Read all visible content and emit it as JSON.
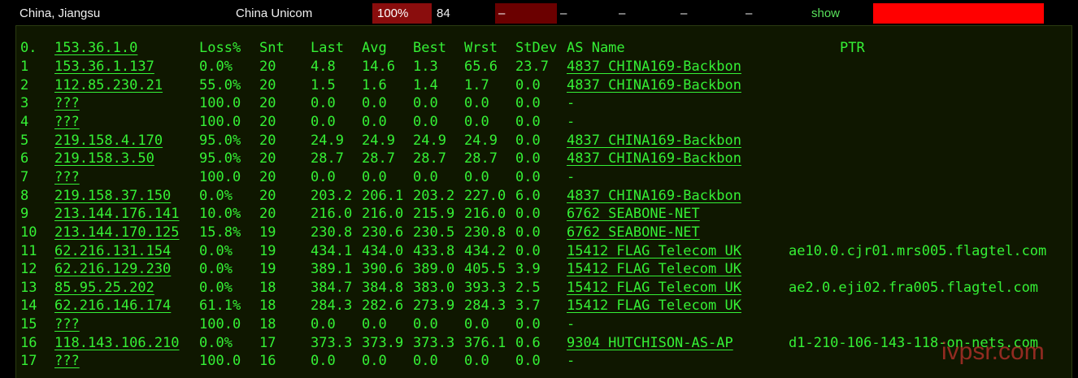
{
  "header": {
    "region": "China, Jiangsu",
    "isp": "China Unicom",
    "loss": "100%",
    "snt": "84",
    "dash_box": "–",
    "dashes": [
      "–",
      "–",
      "–",
      "–"
    ],
    "show_label": "show",
    "colors": {
      "loss_box": "#8a0d0d",
      "dash_box": "#6b0000",
      "bar": "#ff0000",
      "link": "#58e05a"
    }
  },
  "columns": {
    "idx": "0.",
    "host": "153.36.1.0",
    "loss": "Loss%",
    "snt": "Snt",
    "last": "Last",
    "avg": "Avg",
    "best": "Best",
    "wrst": "Wrst",
    "stdev": "StDev",
    "as": "AS Name",
    "ptr": "PTR"
  },
  "hops": [
    {
      "idx": "1",
      "host": "153.36.1.137",
      "loss": "0.0%",
      "snt": "20",
      "last": "4.8",
      "avg": "14.6",
      "best": "1.3",
      "wrst": "65.6",
      "stdev": "23.7",
      "as": "4837  CHINA169-Backbon",
      "ptr": ""
    },
    {
      "idx": "2",
      "host": "112.85.230.21",
      "loss": "55.0%",
      "snt": "20",
      "last": "1.5",
      "avg": "1.6",
      "best": "1.4",
      "wrst": "1.7",
      "stdev": "0.0",
      "as": "4837  CHINA169-Backbon",
      "ptr": ""
    },
    {
      "idx": "3",
      "host": "???",
      "loss": "100.0",
      "snt": "20",
      "last": "0.0",
      "avg": "0.0",
      "best": "0.0",
      "wrst": "0.0",
      "stdev": "0.0",
      "as": "-",
      "ptr": ""
    },
    {
      "idx": "4",
      "host": "???",
      "loss": "100.0",
      "snt": "20",
      "last": "0.0",
      "avg": "0.0",
      "best": "0.0",
      "wrst": "0.0",
      "stdev": "0.0",
      "as": "-",
      "ptr": ""
    },
    {
      "idx": "5",
      "host": "219.158.4.170",
      "loss": "95.0%",
      "snt": "20",
      "last": "24.9",
      "avg": "24.9",
      "best": "24.9",
      "wrst": "24.9",
      "stdev": "0.0",
      "as": "4837  CHINA169-Backbon",
      "ptr": ""
    },
    {
      "idx": "6",
      "host": "219.158.3.50",
      "loss": "95.0%",
      "snt": "20",
      "last": "28.7",
      "avg": "28.7",
      "best": "28.7",
      "wrst": "28.7",
      "stdev": "0.0",
      "as": "4837  CHINA169-Backbon",
      "ptr": ""
    },
    {
      "idx": "7",
      "host": "???",
      "loss": "100.0",
      "snt": "20",
      "last": "0.0",
      "avg": "0.0",
      "best": "0.0",
      "wrst": "0.0",
      "stdev": "0.0",
      "as": "-",
      "ptr": ""
    },
    {
      "idx": "8",
      "host": "219.158.37.150",
      "loss": "0.0%",
      "snt": "20",
      "last": "203.2",
      "avg": "206.1",
      "best": "203.2",
      "wrst": "227.0",
      "stdev": "6.0",
      "as": "4837  CHINA169-Backbon",
      "ptr": ""
    },
    {
      "idx": "9",
      "host": "213.144.176.141",
      "loss": "10.0%",
      "snt": "20",
      "last": "216.0",
      "avg": "216.0",
      "best": "215.9",
      "wrst": "216.0",
      "stdev": "0.0",
      "as": "6762  SEABONE-NET",
      "ptr": ""
    },
    {
      "idx": "10",
      "host": "213.144.170.125",
      "loss": "15.8%",
      "snt": "19",
      "last": "230.8",
      "avg": "230.6",
      "best": "230.5",
      "wrst": "230.8",
      "stdev": "0.0",
      "as": "6762  SEABONE-NET",
      "ptr": ""
    },
    {
      "idx": "11",
      "host": "62.216.131.154",
      "loss": "0.0%",
      "snt": "19",
      "last": "434.1",
      "avg": "434.0",
      "best": "433.8",
      "wrst": "434.2",
      "stdev": "0.0",
      "as": "15412 FLAG Telecom UK",
      "ptr": "ae10.0.cjr01.mrs005.flagtel.com"
    },
    {
      "idx": "12",
      "host": "62.216.129.230",
      "loss": "0.0%",
      "snt": "19",
      "last": "389.1",
      "avg": "390.6",
      "best": "389.0",
      "wrst": "405.5",
      "stdev": "3.9",
      "as": "15412 FLAG Telecom UK",
      "ptr": ""
    },
    {
      "idx": "13",
      "host": "85.95.25.202",
      "loss": "0.0%",
      "snt": "18",
      "last": "384.7",
      "avg": "384.8",
      "best": "383.0",
      "wrst": "393.3",
      "stdev": "2.5",
      "as": "15412 FLAG Telecom UK",
      "ptr": "ae2.0.eji02.fra005.flagtel.com"
    },
    {
      "idx": "14",
      "host": "62.216.146.174",
      "loss": "61.1%",
      "snt": "18",
      "last": "284.3",
      "avg": "282.6",
      "best": "273.9",
      "wrst": "284.3",
      "stdev": "3.7",
      "as": "15412 FLAG Telecom UK",
      "ptr": ""
    },
    {
      "idx": "15",
      "host": "???",
      "loss": "100.0",
      "snt": "18",
      "last": "0.0",
      "avg": "0.0",
      "best": "0.0",
      "wrst": "0.0",
      "stdev": "0.0",
      "as": "-",
      "ptr": ""
    },
    {
      "idx": "16",
      "host": "118.143.106.210",
      "loss": "0.0%",
      "snt": "17",
      "last": "373.3",
      "avg": "373.9",
      "best": "373.3",
      "wrst": "376.1",
      "stdev": "0.6",
      "as": "9304  HUTCHISON-AS-AP",
      "ptr": "d1-210-106-143-118-on-nets.com"
    },
    {
      "idx": "17",
      "host": "???",
      "loss": "100.0",
      "snt": "16",
      "last": "0.0",
      "avg": "0.0",
      "best": "0.0",
      "wrst": "0.0",
      "stdev": "0.0",
      "as": "-",
      "ptr": ""
    }
  ],
  "watermark": "ivpsr.com",
  "colors": {
    "text": "#35f035",
    "panel_bg": "#0f1700",
    "page_bg": "#000000"
  }
}
